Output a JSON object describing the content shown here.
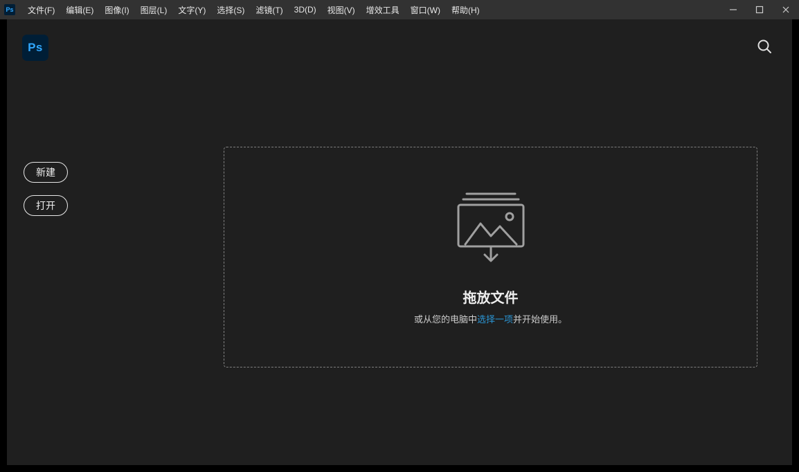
{
  "titlebar": {
    "app_icon_label": "Ps",
    "menu": [
      "文件(F)",
      "编辑(E)",
      "图像(I)",
      "图层(L)",
      "文字(Y)",
      "选择(S)",
      "滤镜(T)",
      "3D(D)",
      "视图(V)",
      "增效工具",
      "窗口(W)",
      "帮助(H)"
    ]
  },
  "topbar": {
    "logo_label": "Ps"
  },
  "sidebar": {
    "new_button": "新建",
    "open_button": "打开"
  },
  "dropzone": {
    "title": "拖放文件",
    "caption_before": "或从您的电脑中",
    "caption_link": "选择一项",
    "caption_after": "并开始使用。"
  }
}
